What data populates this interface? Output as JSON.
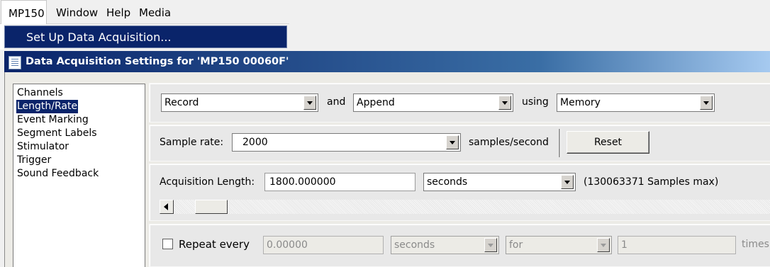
{
  "menubar": {
    "items": [
      "MP150",
      "Window",
      "Help",
      "Media"
    ],
    "dropdown_item": "Set Up Data Acquisition..."
  },
  "dialog": {
    "title": "Data Acquisition Settings for 'MP150 00060F'"
  },
  "sidebar": {
    "items": [
      "Channels",
      "Length/Rate",
      "Event Marking",
      "Segment Labels",
      "Stimulator",
      "Trigger",
      "Sound Feedback"
    ],
    "selected": "Length/Rate"
  },
  "mode_row": {
    "mode_value": "Record",
    "and_label": "and",
    "append_value": "Append",
    "using_label": "using",
    "storage_value": "Memory"
  },
  "sample_rate": {
    "label": "Sample rate:",
    "value": "2000",
    "unit_label": "samples/second",
    "reset_label": "Reset"
  },
  "acquisition": {
    "label": "Acquisition Length:",
    "value": "1800.000000",
    "unit_value": "seconds",
    "max_note": "(130063371 Samples max)"
  },
  "repeat": {
    "checked": false,
    "label": "Repeat every",
    "interval_value": "0.00000",
    "unit_value": "seconds",
    "for_value": "for",
    "count_value": "1",
    "times_label": "times"
  },
  "colors": {
    "selection": "#0a246a",
    "titlebar_start": "#0a246a",
    "titlebar_end": "#a6caf0"
  }
}
